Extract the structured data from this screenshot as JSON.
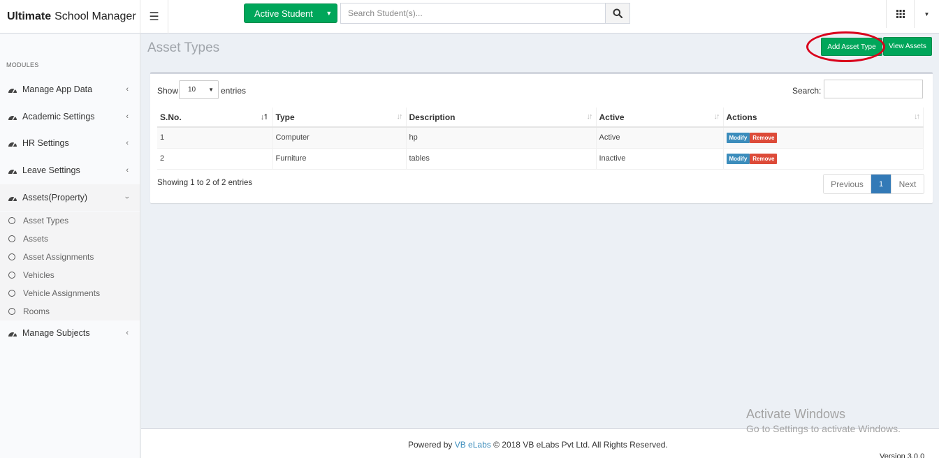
{
  "brand": {
    "bold": "Ultimate",
    "rest": "School Manager"
  },
  "topbar": {
    "active_student_label": "Active Student",
    "search_placeholder": "Search Student(s)..."
  },
  "sidebar": {
    "modules_header": "MODULES",
    "items": [
      {
        "label": "Manage App Data"
      },
      {
        "label": "Academic Settings"
      },
      {
        "label": "HR Settings"
      },
      {
        "label": "Leave Settings"
      },
      {
        "label": "Assets(Property)"
      },
      {
        "label": "Manage Subjects"
      }
    ],
    "sub_items": [
      {
        "label": "Asset Types"
      },
      {
        "label": "Assets"
      },
      {
        "label": "Asset Assignments"
      },
      {
        "label": "Vehicles"
      },
      {
        "label": "Vehicle Assignments"
      },
      {
        "label": "Rooms"
      }
    ]
  },
  "content": {
    "title": "Asset Types",
    "add_button": "Add Asset Type",
    "view_button": "View Assets"
  },
  "table_controls": {
    "show_label": "Show",
    "length_value": "10",
    "entries_label": "entries",
    "search_label": "Search:"
  },
  "table": {
    "columns": [
      "S.No.",
      "Type",
      "Description",
      "Active",
      "Actions"
    ],
    "rows": [
      {
        "sno": "1",
        "type": "Computer",
        "description": "hp",
        "active": "Active"
      },
      {
        "sno": "2",
        "type": "Furniture",
        "description": "tables",
        "active": "Inactive"
      }
    ],
    "modify_label": "Modify",
    "remove_label": "Remove"
  },
  "pagination": {
    "info": "Showing 1 to 2 of 2 entries",
    "previous": "Previous",
    "current": "1",
    "next": "Next"
  },
  "watermark": {
    "line1": "Activate Windows",
    "line2": "Go to Settings to activate Windows."
  },
  "footer": {
    "powered_by": "Powered by",
    "link": "VB eLabs",
    "copyright": "© 2018 VB eLabs Pvt Ltd. All Rights Reserved.",
    "version": "Version 3.0.0"
  },
  "colors": {
    "success": "#00a65a",
    "primary": "#3c8dbc",
    "danger": "#dd4b39",
    "highlight": "#d9001b"
  }
}
